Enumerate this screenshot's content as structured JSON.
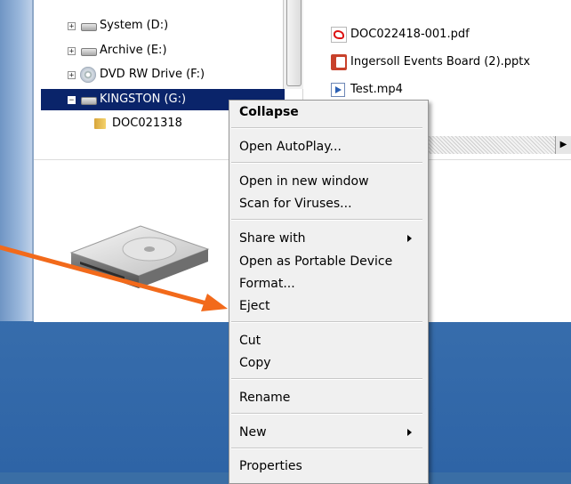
{
  "tree": {
    "items": [
      {
        "label": "System (D:)",
        "expander": "+"
      },
      {
        "label": "Archive (E:)",
        "expander": "+"
      },
      {
        "label": "DVD RW Drive (F:)",
        "expander": "+"
      },
      {
        "label": "KINGSTON (G:)",
        "expander": "−"
      },
      {
        "label": "DOC021318"
      }
    ]
  },
  "files": {
    "items": [
      {
        "label": "DOC022418-001.pdf",
        "icon": "pdf-icon"
      },
      {
        "label": "Ingersoll Events Board (2).pptx",
        "icon": "pptx-icon"
      },
      {
        "label": "Test.mp4",
        "icon": "video-file-icon"
      }
    ]
  },
  "context_menu": {
    "items": [
      {
        "label": "Collapse",
        "bold": true
      },
      {
        "label": "Open AutoPlay..."
      },
      {
        "label": "Open in new window"
      },
      {
        "label": "Scan for Viruses..."
      },
      {
        "label": "Share with",
        "submenu": true
      },
      {
        "label": "Open as Portable Device"
      },
      {
        "label": "Format..."
      },
      {
        "label": "Eject"
      },
      {
        "label": "Cut"
      },
      {
        "label": "Copy"
      },
      {
        "label": "Rename"
      },
      {
        "label": "New",
        "submenu": true
      },
      {
        "label": "Properties"
      }
    ]
  },
  "colors": {
    "selection": "#0a246a",
    "annotation_arrow": "#f26a1b",
    "menu_bg": "#f0f0f0",
    "desktop": "#3a6ea5"
  }
}
